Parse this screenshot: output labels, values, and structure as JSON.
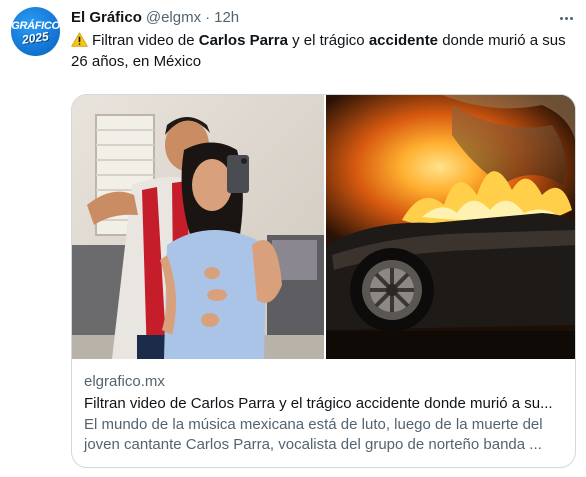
{
  "author": {
    "name": "El Gráfico",
    "handle": "@elgmx",
    "separator": "·",
    "time": "12h",
    "avatar_logo_top": "GRÁFICO",
    "avatar_logo_bottom": "2025"
  },
  "tweet": {
    "warning_icon": "warning-icon",
    "text_part1": "Filtran video de ",
    "text_bold1": "Carlos Parra",
    "text_part2": " y el trágico ",
    "text_bold2": "accidente",
    "text_part3": " donde murió a sus 26 años, en México"
  },
  "card": {
    "domain": "elgrafico.mx",
    "title": "Filtran video de Carlos Parra y el trágico accidente donde murió a su...",
    "description": "El mundo de la música mexicana está de luto, luego de la muerte del joven cantante Carlos Parra, vocalista del grupo de norteño banda ..."
  },
  "icons": {
    "more": "more-options-icon"
  },
  "colors": {
    "text_primary": "#0f1419",
    "text_secondary": "#536471",
    "border": "#cfd9de",
    "avatar_blue": "#1577d6",
    "warning_yellow": "#f5c518"
  }
}
